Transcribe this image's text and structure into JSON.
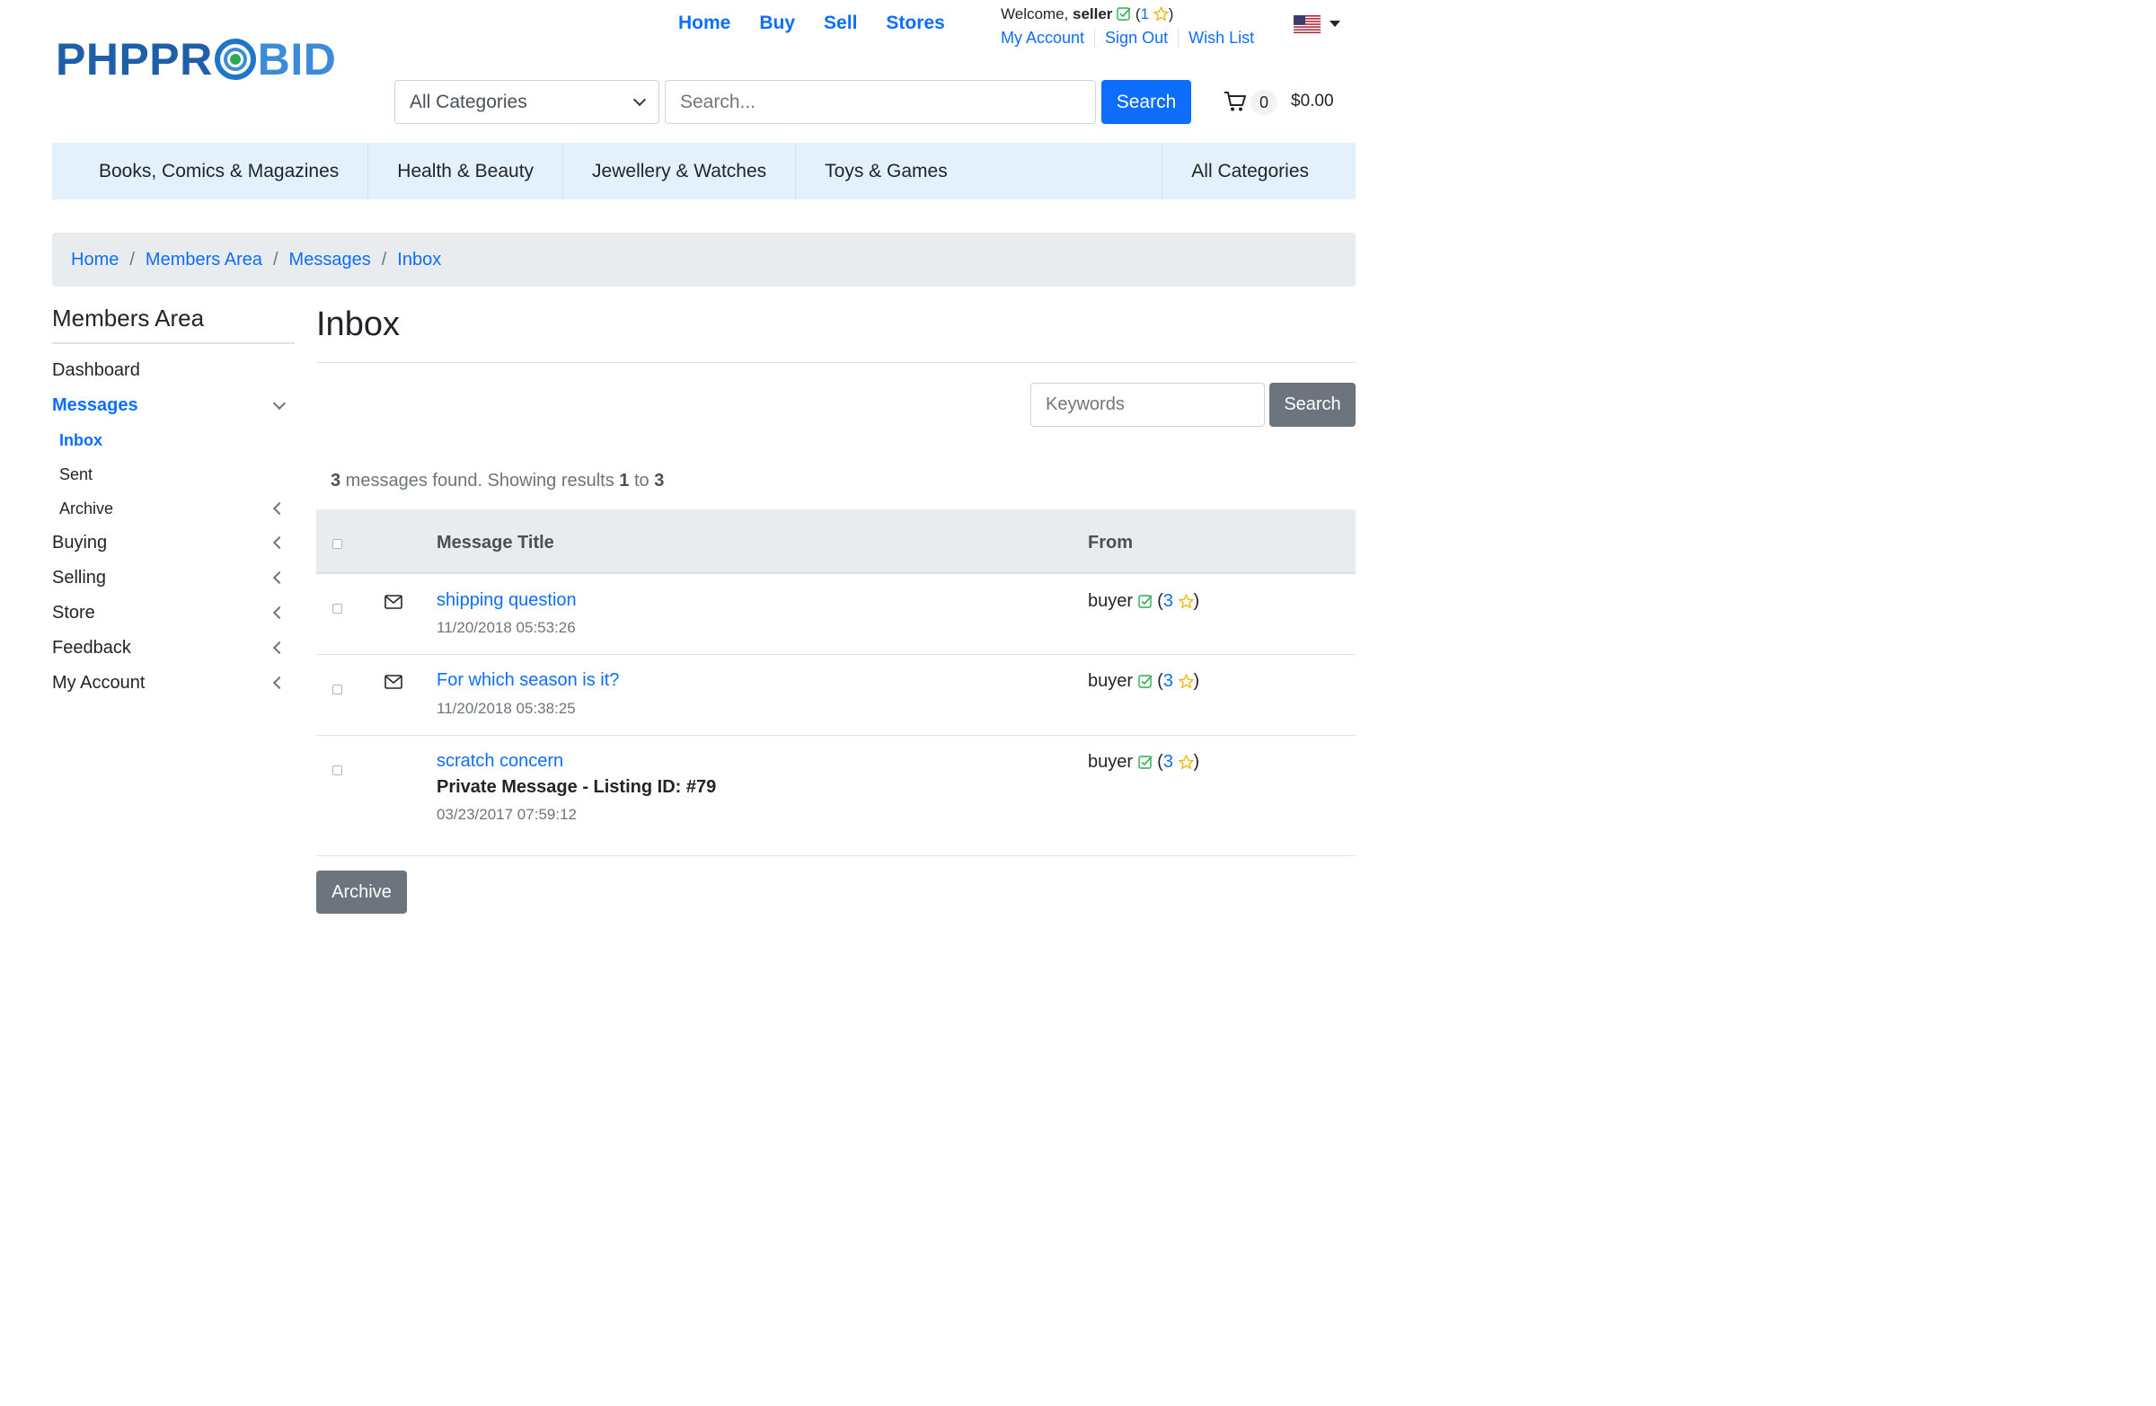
{
  "logo": {
    "part1": "PHPPR",
    "part2": "BID"
  },
  "topnav": {
    "home": "Home",
    "buy": "Buy",
    "sell": "Sell",
    "stores": "Stores"
  },
  "user": {
    "welcome": "Welcome,",
    "name": "seller",
    "rating_open": "(",
    "rating": "1",
    "rating_close": ")"
  },
  "account_links": {
    "my_account": "My Account",
    "sign_out": "Sign Out",
    "wish_list": "Wish List"
  },
  "search": {
    "category": "All Categories",
    "placeholder": "Search...",
    "button": "Search"
  },
  "cart": {
    "count": "0",
    "total": "$0.00"
  },
  "categories": [
    "Books, Comics & Magazines",
    "Health & Beauty",
    "Jewellery & Watches",
    "Toys & Games",
    "All Categories"
  ],
  "breadcrumb": [
    "Home",
    "Members Area",
    "Messages",
    "Inbox"
  ],
  "breadcrumb_sep": "/",
  "sidebar": {
    "title": "Members Area",
    "dashboard": "Dashboard",
    "messages": "Messages",
    "inbox": "Inbox",
    "sent": "Sent",
    "archive": "Archive",
    "buying": "Buying",
    "selling": "Selling",
    "store": "Store",
    "feedback": "Feedback",
    "my_account": "My Account"
  },
  "page": {
    "title": "Inbox",
    "keywords_placeholder": "Keywords",
    "search_button": "Search",
    "summary_count": "3",
    "summary_mid": " messages found. Showing results ",
    "summary_from": "1",
    "summary_to_word": " to ",
    "summary_to": "3",
    "archive_button": "Archive"
  },
  "table": {
    "col_title": "Message Title",
    "col_from": "From",
    "rows": [
      {
        "title": "shipping question",
        "subtitle": "",
        "date": "11/20/2018 05:53:26",
        "from": "buyer",
        "score": "3",
        "unread": true
      },
      {
        "title": "For which season is it?",
        "subtitle": "",
        "date": "11/20/2018 05:38:25",
        "from": "buyer",
        "score": "3",
        "unread": true
      },
      {
        "title": "scratch concern",
        "subtitle": "Private Message - Listing ID: #79",
        "date": "03/23/2017 07:59:12",
        "from": "buyer",
        "score": "3",
        "unread": false
      }
    ]
  },
  "colors": {
    "primary": "#0d6efd",
    "secondary": "#6c757d",
    "category_bar": "#e3f1fd",
    "breadcrumb_bg": "#e9ecef",
    "verified": "#2eab52",
    "star": "#f0b400"
  }
}
